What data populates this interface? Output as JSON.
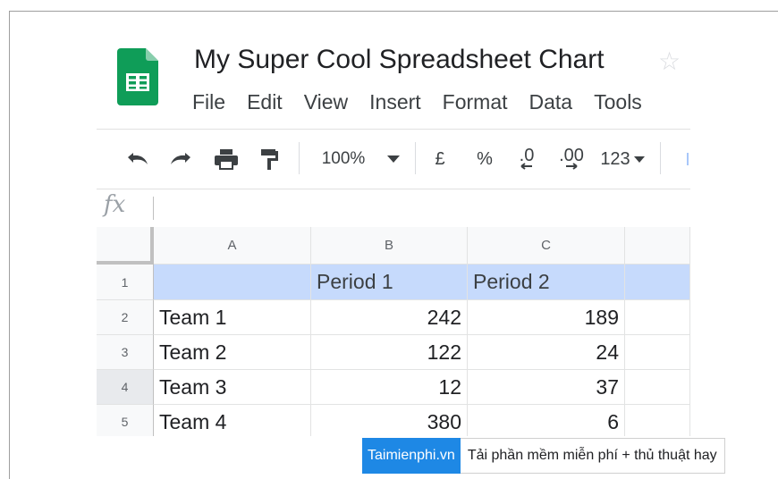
{
  "document": {
    "title": "My Super Cool Spreadsheet Chart",
    "logo": "google-sheets-icon",
    "star": "star-icon"
  },
  "menu": [
    "File",
    "Edit",
    "View",
    "Insert",
    "Format",
    "Data",
    "Tools"
  ],
  "toolbar": {
    "undo": "undo-icon",
    "redo": "redo-icon",
    "print": "print-icon",
    "paint_format": "paint-format-icon",
    "zoom": "100%",
    "currency": "£",
    "percent": "%",
    "decrease_decimal": ".0",
    "increase_decimal": ".00",
    "more_formats": "123"
  },
  "formula_bar": {
    "label": "fx"
  },
  "grid": {
    "columns": [
      "A",
      "B",
      "C"
    ],
    "rows": [
      {
        "num": "1",
        "cells": [
          "",
          "Period 1",
          "Period 2"
        ]
      },
      {
        "num": "2",
        "cells": [
          "Team 1",
          "242",
          "189"
        ]
      },
      {
        "num": "3",
        "cells": [
          "Team 2",
          "122",
          "24"
        ]
      },
      {
        "num": "4",
        "cells": [
          "Team 3",
          "12",
          "37"
        ]
      },
      {
        "num": "5",
        "cells": [
          "Team 4",
          "380",
          "6"
        ]
      }
    ]
  },
  "watermark": {
    "brand": "Taimienphi.vn",
    "tagline": "Tải phần mềm miễn phí + thủ thuật hay"
  },
  "colors": {
    "sheets_green": "#0f9d58",
    "selection_blue": "#c6dafc",
    "watermark_blue": "#1e88e5"
  }
}
